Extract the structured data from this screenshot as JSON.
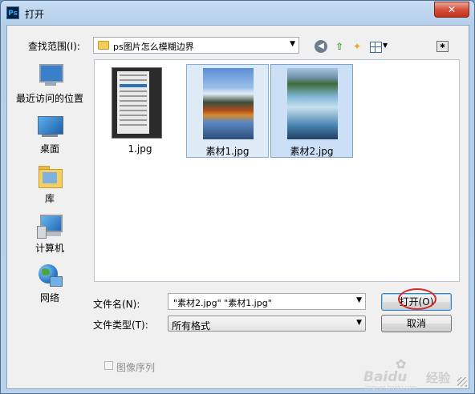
{
  "window": {
    "title": "打开",
    "app_icon_text": "Ps",
    "close_glyph": "✕"
  },
  "toolbar": {
    "lookin_label": "查找范围(I):",
    "lookin_value": "ps图片怎么模糊边界",
    "combo_arrow": "▼",
    "views_arrow": "▼"
  },
  "places": [
    {
      "label": "最近访问的位置",
      "icon": "recent-places-icon"
    },
    {
      "label": "桌面",
      "icon": "desktop-icon"
    },
    {
      "label": "库",
      "icon": "library-icon"
    },
    {
      "label": "计算机",
      "icon": "computer-icon"
    },
    {
      "label": "网络",
      "icon": "network-icon"
    }
  ],
  "files": [
    {
      "name": "1.jpg",
      "selected": false
    },
    {
      "name": "素材1.jpg",
      "selected": true
    },
    {
      "name": "素材2.jpg",
      "selected": true
    }
  ],
  "form": {
    "filename_label": "文件名(N):",
    "filename_value": "\"素材2.jpg\" \"素材1.jpg\"",
    "filetype_label": "文件类型(T):",
    "filetype_value": "所有格式",
    "open_button": "打开(O)",
    "cancel_button": "取消",
    "image_sequence_label": "图像序列",
    "image_sequence_checked": false
  },
  "watermark": {
    "brand": "Baidu",
    "jingyan": "经验",
    "url": "jingyan.baidu.com"
  },
  "colors": {
    "selection_fill": "#cbe0f6",
    "annotation_circle": "#d42a2a",
    "titlebar": "#b9d1ea"
  }
}
